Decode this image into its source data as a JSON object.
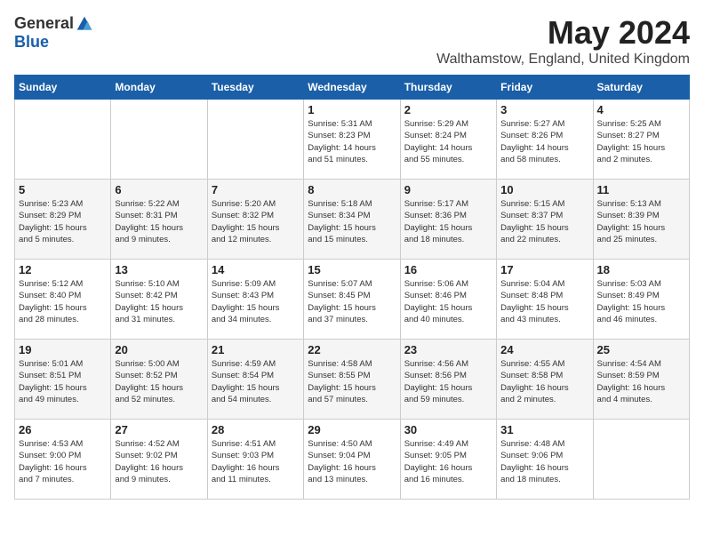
{
  "logo": {
    "general": "General",
    "blue": "Blue"
  },
  "title": "May 2024",
  "location": "Walthamstow, England, United Kingdom",
  "days_of_week": [
    "Sunday",
    "Monday",
    "Tuesday",
    "Wednesday",
    "Thursday",
    "Friday",
    "Saturday"
  ],
  "weeks": [
    [
      {
        "day": "",
        "info": ""
      },
      {
        "day": "",
        "info": ""
      },
      {
        "day": "",
        "info": ""
      },
      {
        "day": "1",
        "info": "Sunrise: 5:31 AM\nSunset: 8:23 PM\nDaylight: 14 hours\nand 51 minutes."
      },
      {
        "day": "2",
        "info": "Sunrise: 5:29 AM\nSunset: 8:24 PM\nDaylight: 14 hours\nand 55 minutes."
      },
      {
        "day": "3",
        "info": "Sunrise: 5:27 AM\nSunset: 8:26 PM\nDaylight: 14 hours\nand 58 minutes."
      },
      {
        "day": "4",
        "info": "Sunrise: 5:25 AM\nSunset: 8:27 PM\nDaylight: 15 hours\nand 2 minutes."
      }
    ],
    [
      {
        "day": "5",
        "info": "Sunrise: 5:23 AM\nSunset: 8:29 PM\nDaylight: 15 hours\nand 5 minutes."
      },
      {
        "day": "6",
        "info": "Sunrise: 5:22 AM\nSunset: 8:31 PM\nDaylight: 15 hours\nand 9 minutes."
      },
      {
        "day": "7",
        "info": "Sunrise: 5:20 AM\nSunset: 8:32 PM\nDaylight: 15 hours\nand 12 minutes."
      },
      {
        "day": "8",
        "info": "Sunrise: 5:18 AM\nSunset: 8:34 PM\nDaylight: 15 hours\nand 15 minutes."
      },
      {
        "day": "9",
        "info": "Sunrise: 5:17 AM\nSunset: 8:36 PM\nDaylight: 15 hours\nand 18 minutes."
      },
      {
        "day": "10",
        "info": "Sunrise: 5:15 AM\nSunset: 8:37 PM\nDaylight: 15 hours\nand 22 minutes."
      },
      {
        "day": "11",
        "info": "Sunrise: 5:13 AM\nSunset: 8:39 PM\nDaylight: 15 hours\nand 25 minutes."
      }
    ],
    [
      {
        "day": "12",
        "info": "Sunrise: 5:12 AM\nSunset: 8:40 PM\nDaylight: 15 hours\nand 28 minutes."
      },
      {
        "day": "13",
        "info": "Sunrise: 5:10 AM\nSunset: 8:42 PM\nDaylight: 15 hours\nand 31 minutes."
      },
      {
        "day": "14",
        "info": "Sunrise: 5:09 AM\nSunset: 8:43 PM\nDaylight: 15 hours\nand 34 minutes."
      },
      {
        "day": "15",
        "info": "Sunrise: 5:07 AM\nSunset: 8:45 PM\nDaylight: 15 hours\nand 37 minutes."
      },
      {
        "day": "16",
        "info": "Sunrise: 5:06 AM\nSunset: 8:46 PM\nDaylight: 15 hours\nand 40 minutes."
      },
      {
        "day": "17",
        "info": "Sunrise: 5:04 AM\nSunset: 8:48 PM\nDaylight: 15 hours\nand 43 minutes."
      },
      {
        "day": "18",
        "info": "Sunrise: 5:03 AM\nSunset: 8:49 PM\nDaylight: 15 hours\nand 46 minutes."
      }
    ],
    [
      {
        "day": "19",
        "info": "Sunrise: 5:01 AM\nSunset: 8:51 PM\nDaylight: 15 hours\nand 49 minutes."
      },
      {
        "day": "20",
        "info": "Sunrise: 5:00 AM\nSunset: 8:52 PM\nDaylight: 15 hours\nand 52 minutes."
      },
      {
        "day": "21",
        "info": "Sunrise: 4:59 AM\nSunset: 8:54 PM\nDaylight: 15 hours\nand 54 minutes."
      },
      {
        "day": "22",
        "info": "Sunrise: 4:58 AM\nSunset: 8:55 PM\nDaylight: 15 hours\nand 57 minutes."
      },
      {
        "day": "23",
        "info": "Sunrise: 4:56 AM\nSunset: 8:56 PM\nDaylight: 15 hours\nand 59 minutes."
      },
      {
        "day": "24",
        "info": "Sunrise: 4:55 AM\nSunset: 8:58 PM\nDaylight: 16 hours\nand 2 minutes."
      },
      {
        "day": "25",
        "info": "Sunrise: 4:54 AM\nSunset: 8:59 PM\nDaylight: 16 hours\nand 4 minutes."
      }
    ],
    [
      {
        "day": "26",
        "info": "Sunrise: 4:53 AM\nSunset: 9:00 PM\nDaylight: 16 hours\nand 7 minutes."
      },
      {
        "day": "27",
        "info": "Sunrise: 4:52 AM\nSunset: 9:02 PM\nDaylight: 16 hours\nand 9 minutes."
      },
      {
        "day": "28",
        "info": "Sunrise: 4:51 AM\nSunset: 9:03 PM\nDaylight: 16 hours\nand 11 minutes."
      },
      {
        "day": "29",
        "info": "Sunrise: 4:50 AM\nSunset: 9:04 PM\nDaylight: 16 hours\nand 13 minutes."
      },
      {
        "day": "30",
        "info": "Sunrise: 4:49 AM\nSunset: 9:05 PM\nDaylight: 16 hours\nand 16 minutes."
      },
      {
        "day": "31",
        "info": "Sunrise: 4:48 AM\nSunset: 9:06 PM\nDaylight: 16 hours\nand 18 minutes."
      },
      {
        "day": "",
        "info": ""
      }
    ]
  ]
}
